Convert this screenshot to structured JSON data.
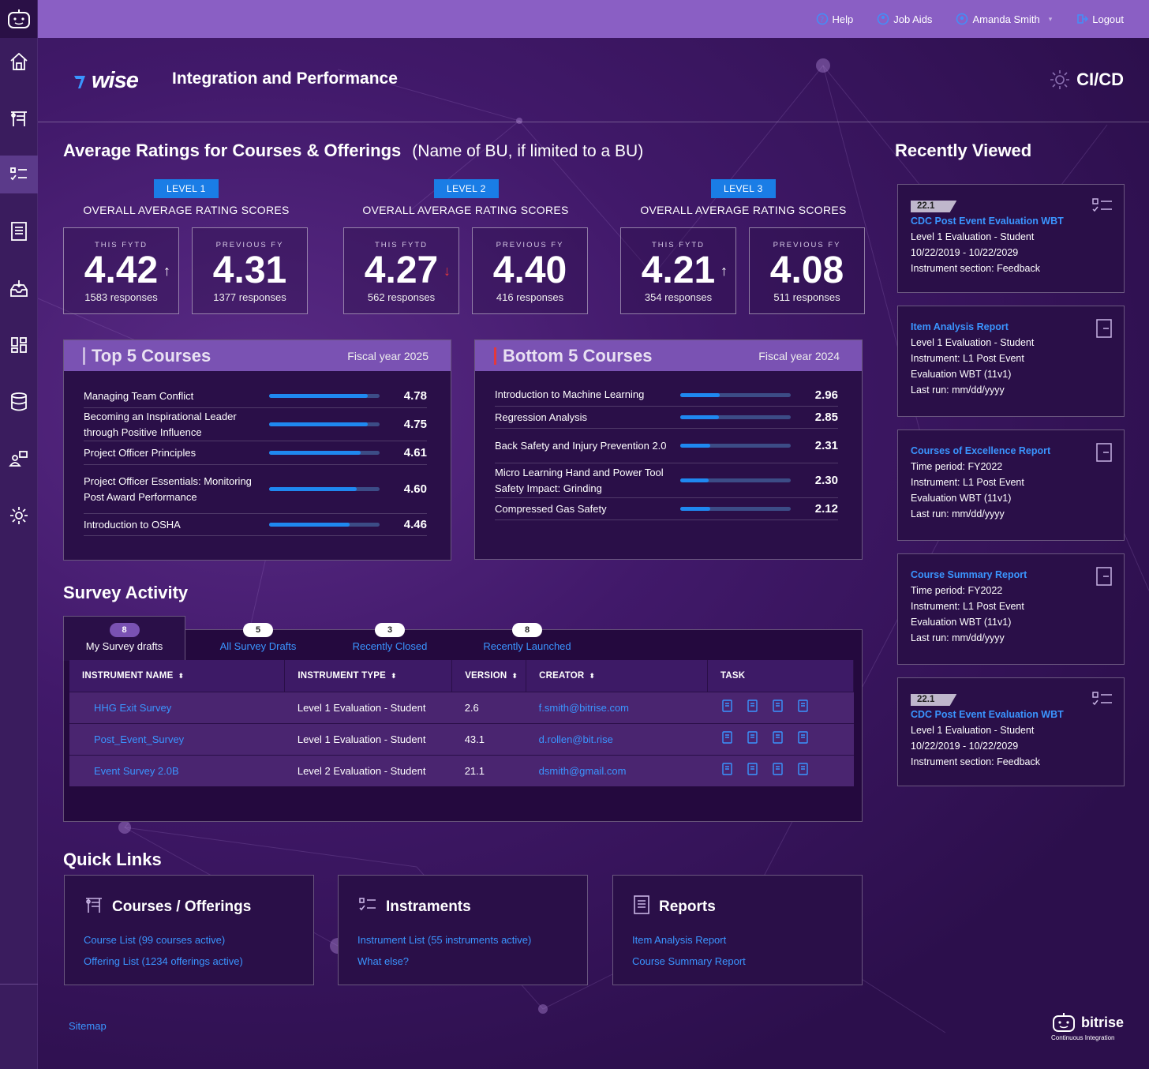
{
  "topbar": {
    "help": "Help",
    "job_aids": "Job Aids",
    "user": "Amanda Smith",
    "logout": "Logout"
  },
  "header": {
    "brand": "wise",
    "title": "Integration and Performance",
    "right_label": "CI/CD"
  },
  "ratings": {
    "heading": "Average Ratings for Courses & Offerings",
    "subheading": "(Name of BU, if limited to a BU)",
    "levels": [
      {
        "badge": "LEVEL 1",
        "title": "OVERALL AVERAGE RATING SCORES",
        "this_caption": "THIS FYTD",
        "this_value": "4.42",
        "this_responses": "1583 responses",
        "trend": "↑",
        "prev_caption": "PREVIOUS FY",
        "prev_value": "4.31",
        "prev_responses": "1377 responses"
      },
      {
        "badge": "LEVEL 2",
        "title": "OVERALL AVERAGE RATING SCORES",
        "this_caption": "THIS FYTD",
        "this_value": "4.27",
        "this_responses": "562 responses",
        "trend": "↓",
        "prev_caption": "PREVIOUS FY",
        "prev_value": "4.40",
        "prev_responses": "416 responses"
      },
      {
        "badge": "LEVEL 3",
        "title": "OVERALL AVERAGE RATING SCORES",
        "this_caption": "THIS FYTD",
        "this_value": "4.21",
        "this_responses": "354 responses",
        "trend": "↑",
        "prev_caption": "PREVIOUS FY",
        "prev_value": "4.08",
        "prev_responses": "511 responses"
      }
    ],
    "trend_colors": {
      "up": "#ffffff",
      "down": "#e5383b"
    }
  },
  "top_courses": {
    "title": "Top 5 Courses",
    "fiscal": "Fiscal year 2025",
    "accent": "#c9b8e0",
    "items": [
      {
        "name": "Managing Team Conflict",
        "value": "4.78",
        "fill": 0.89
      },
      {
        "name": "Becoming an Inspirational Leader through Positive Influence",
        "value": "4.75",
        "fill": 0.89
      },
      {
        "name": "Project Officer Principles",
        "value": "4.61",
        "fill": 0.83
      },
      {
        "name": "Project Officer Essentials: Monitoring Post Award Performance",
        "value": "4.60",
        "fill": 0.79
      },
      {
        "name": "Introduction to OSHA",
        "value": "4.46",
        "fill": 0.73
      }
    ]
  },
  "bottom_courses": {
    "title": "Bottom  5 Courses",
    "fiscal": "Fiscal year 2024",
    "accent": "#e5383b",
    "items": [
      {
        "name": "Introduction to Machine Learning",
        "value": "2.96",
        "fill": 0.36
      },
      {
        "name": "Regression Analysis",
        "value": "2.85",
        "fill": 0.35
      },
      {
        "name": "Back Safety and Injury Prevention 2.0",
        "value": "2.31",
        "fill": 0.27
      },
      {
        "name": "Micro Learning Hand and Power Tool Safety Impact: Grinding",
        "value": "2.30",
        "fill": 0.26
      },
      {
        "name": "Compressed Gas Safety",
        "value": "2.12",
        "fill": 0.27
      }
    ]
  },
  "survey": {
    "heading": "Survey Activity",
    "tabs": [
      {
        "count": "8",
        "label": "My Survey drafts"
      },
      {
        "count": "5",
        "label": "All Survey Drafts"
      },
      {
        "count": "3",
        "label": "Recently Closed"
      },
      {
        "count": "8",
        "label": "Recently Launched"
      }
    ],
    "columns": [
      "INSTRUMENT NAME",
      "INSTRUMENT TYPE",
      "VERSION",
      "CREATOR",
      "TASK"
    ],
    "rows": [
      {
        "name": "HHG Exit Survey",
        "type": "Level 1 Evaluation - Student",
        "version": "2.6",
        "creator": "f.smith@bitrise.com"
      },
      {
        "name": "Post_Event_Survey",
        "type": "Level 1 Evaluation - Student",
        "version": "43.1",
        "creator": "d.rollen@bit.rise"
      },
      {
        "name": "Event Survey 2.0B",
        "type": "Level 2 Evaluation - Student",
        "version": "21.1",
        "creator": "dsmith@gmail.com"
      }
    ]
  },
  "recently_viewed": {
    "heading": "Recently Viewed",
    "items": [
      {
        "tag": "22.1",
        "title": "CDC Post Event Evaluation WBT",
        "lines": [
          "Level 1 Evaluation - Student",
          "10/22/2019 - 10/22/2029",
          "Instrument section: Feedback"
        ],
        "icon": "checklist-icon"
      },
      {
        "tag": "",
        "title": "Item Analysis Report",
        "lines": [
          "Level 1 Evaluation - Student",
          "Instrument: L1 Post Event",
          "Evaluation WBT (11v1)",
          "Last run: mm/dd/yyyy"
        ],
        "icon": "report-icon"
      },
      {
        "tag": "",
        "title": "Courses of Excellence Report",
        "lines": [
          "Time period: FY2022",
          "Instrument: L1 Post Event",
          "Evaluation WBT (11v1)",
          "Last run: mm/dd/yyyy"
        ],
        "icon": "report-icon"
      },
      {
        "tag": "",
        "title": "Course Summary Report",
        "lines": [
          "Time period: FY2022",
          "Instrument: L1 Post Event",
          "Evaluation WBT (11v1)",
          "Last run: mm/dd/yyyy"
        ],
        "icon": "report-icon"
      },
      {
        "tag": "22.1",
        "title": "CDC Post Event Evaluation WBT",
        "lines": [
          "Level 1 Evaluation - Student",
          "10/22/2019 - 10/22/2029",
          "Instrument section: Feedback"
        ],
        "icon": "checklist-icon"
      }
    ]
  },
  "quick_links": {
    "heading": "Quick Links",
    "cards": [
      {
        "title": "Courses / Offerings",
        "link1": "Course List (99 courses active)",
        "link2": "Offering List (1234 offerings active)"
      },
      {
        "title": "Instraments",
        "link1": "Instrument List (55 instruments active)",
        "link2": "What else?"
      },
      {
        "title": "Reports",
        "link1": "Item Analysis Report",
        "link2": "Course Summary Report"
      }
    ]
  },
  "footer": {
    "sitemap": "Sitemap",
    "brand": "bitrise",
    "brand_sub": "Continuous Integration"
  }
}
